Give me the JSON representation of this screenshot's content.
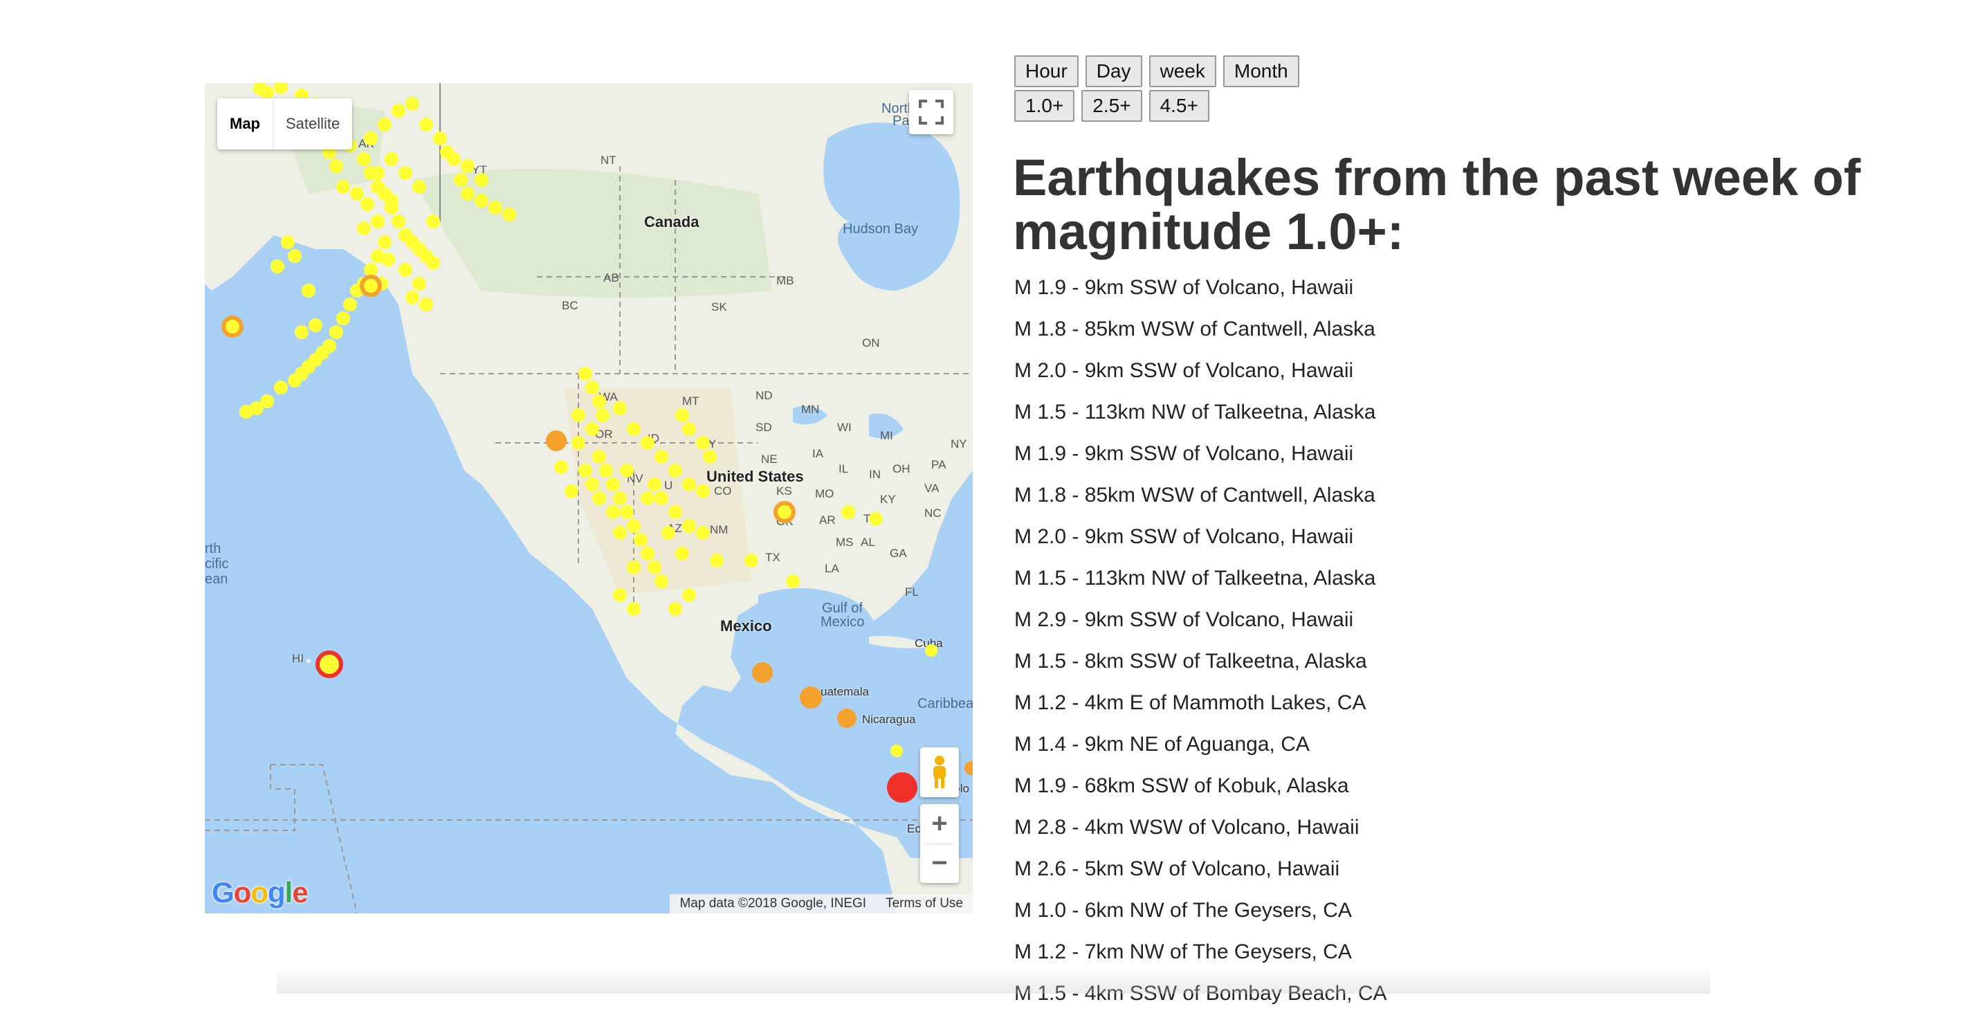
{
  "map": {
    "type_buttons": {
      "map": "Map",
      "satellite": "Satellite"
    },
    "attribution": {
      "data": "Map data ©2018 Google, INEGI",
      "terms": "Terms of Use"
    },
    "logo": "Google",
    "labels": {
      "canada": "Canada",
      "united_states": "United States",
      "mexico": "Mexico",
      "hudson_bay": "Hudson Bay",
      "gulf_of_mexico_1": "Gulf of",
      "gulf_of_mexico_2": "Mexico",
      "north_pacific_1": "rth",
      "north_pacific_2": "cific",
      "north_pacific_3": "ean",
      "north_pass_1": "North",
      "north_pass_2": "Pass",
      "caribbean": "Caribbea",
      "cuba": "Cuba",
      "guatemala": "uatemala",
      "nicaragua": "Nicaragua",
      "colombia": "Colo",
      "ecuador": "Ec",
      "hi": "HI",
      "ak": "AK",
      "yt": "YT",
      "nt": "NT",
      "bc": "BC",
      "ab": "AB",
      "sk": "SK",
      "mb": "MB",
      "on": "ON",
      "wa": "WA",
      "or": "OR",
      "id": "ID",
      "mt": "MT",
      "wy": "WY",
      "nd": "ND",
      "sd": "SD",
      "ne": "NE",
      "mn": "MN",
      "wi": "WI",
      "mi": "MI",
      "ia": "IA",
      "il": "IL",
      "in": "IN",
      "oh": "OH",
      "pa": "PA",
      "ny": "NY",
      "nv": "NV",
      "ut": "U",
      "co": "CO",
      "ks": "KS",
      "mo": "MO",
      "ky": "KY",
      "va": "VA",
      "nc": "NC",
      "tn": "TN",
      "ar": "AR",
      "ok": "OK",
      "az": "AZ",
      "nm": "NM",
      "tx": "TX",
      "la": "LA",
      "ms": "MS",
      "al": "AL",
      "ga": "GA",
      "fl": "FL"
    },
    "colors": {
      "ocean": "#a9d0f5",
      "land": "#eef0e6",
      "small_quake": "#ffff33",
      "medium_quake": "#f5a12e",
      "large_quake": "#f0302a"
    }
  },
  "controls": {
    "time": [
      "Hour",
      "Day",
      "week",
      "Month"
    ],
    "magnitude": [
      "1.0+",
      "2.5+",
      "4.5+"
    ]
  },
  "heading": "Earthquakes from the past week of magnitude 1.0+:",
  "quakes": [
    "M 1.9 - 9km SSW of Volcano, Hawaii",
    "M 1.8 - 85km WSW of Cantwell, Alaska",
    "M 2.0 - 9km SSW of Volcano, Hawaii",
    "M 1.5 - 113km NW of Talkeetna, Alaska",
    "M 1.9 - 9km SSW of Volcano, Hawaii",
    "M 1.8 - 85km WSW of Cantwell, Alaska",
    "M 2.0 - 9km SSW of Volcano, Hawaii",
    "M 1.5 - 113km NW of Talkeetna, Alaska",
    "M 2.9 - 9km SSW of Volcano, Hawaii",
    "M 1.5 - 8km SSW of Talkeetna, Alaska",
    "M 1.2 - 4km E of Mammoth Lakes, CA",
    "M 1.4 - 9km NE of Aguanga, CA",
    "M 1.9 - 68km SSW of Kobuk, Alaska",
    "M 2.8 - 4km WSW of Volcano, Hawaii",
    "M 2.6 - 5km SW of Volcano, Hawaii",
    "M 1.0 - 6km NW of The Geysers, CA",
    "M 1.2 - 7km NW of The Geysers, CA",
    "M 1.5 - 4km SSW of Bombay Beach, CA"
  ]
}
